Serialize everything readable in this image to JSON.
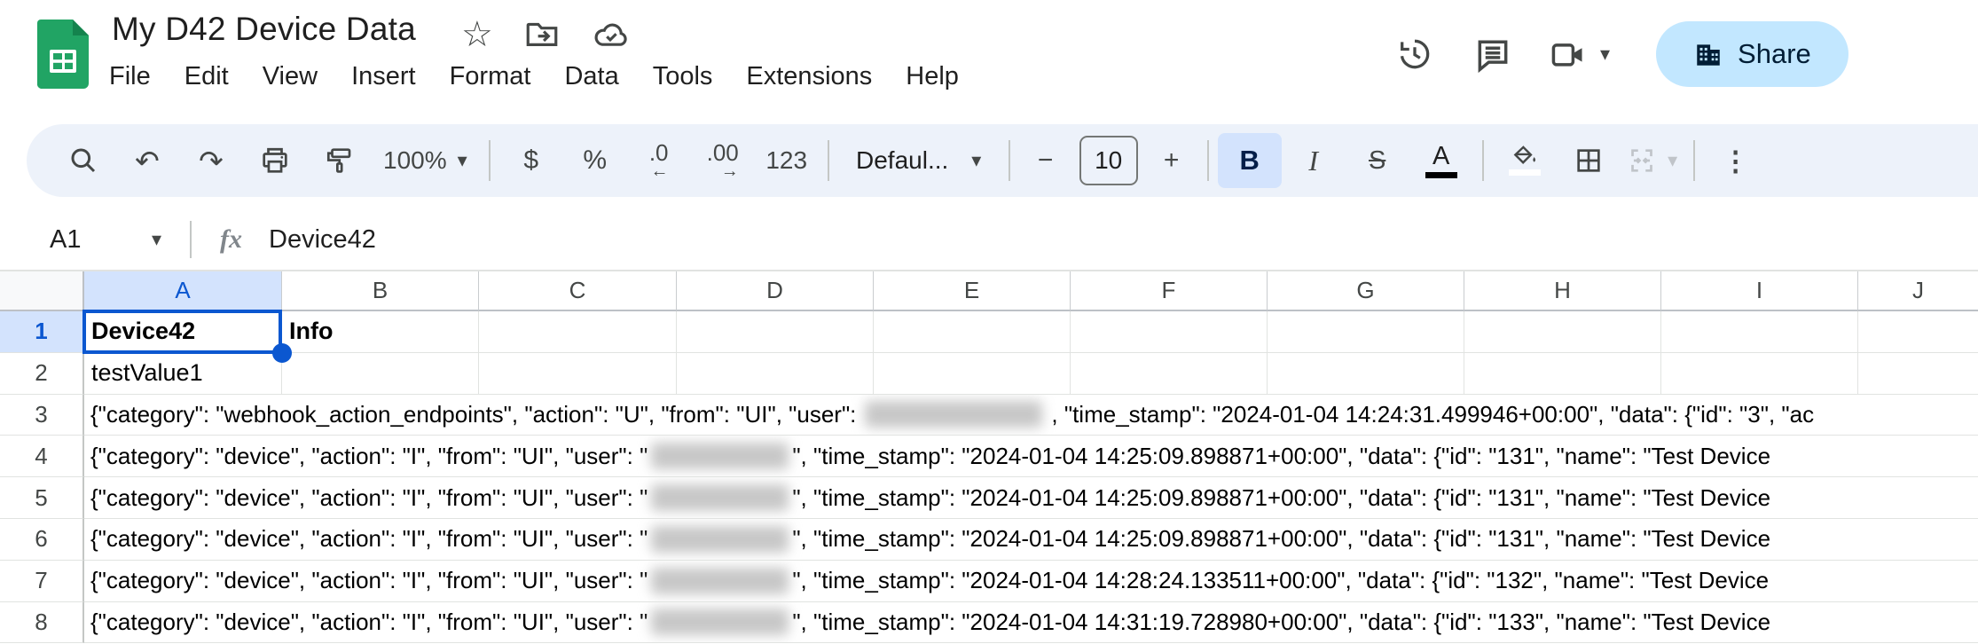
{
  "header": {
    "title": "My D42 Device Data",
    "menus": [
      "File",
      "Edit",
      "View",
      "Insert",
      "Format",
      "Data",
      "Tools",
      "Extensions",
      "Help"
    ],
    "share_label": "Share"
  },
  "icons": {
    "star": "☆",
    "caret": "▾",
    "undo": "↶",
    "redo": "↷",
    "more_vertical": "⋮",
    "minus": "−",
    "plus": "+",
    "arrow_left": "←",
    "arrow_right": "→"
  },
  "toolbar": {
    "zoom": "100%",
    "currency": "$",
    "percent": "%",
    "decrease_decimal": ".0",
    "increase_decimal": ".00",
    "more_formats": "123",
    "font_name": "Defaul...",
    "font_size": "10",
    "bold": "B",
    "italic": "I",
    "strikethrough": "S",
    "text_color": "A"
  },
  "formula_bar": {
    "cell_ref": "A1",
    "fx": "fx",
    "value": "Device42"
  },
  "colors": {
    "accent_blue": "#0b57d0",
    "share_bg": "#c2e7ff",
    "toolbar_bg": "#edf2fa",
    "selection_header_bg": "#d3e3fd",
    "logo_green": "#21a464"
  },
  "grid": {
    "columns": [
      "A",
      "B",
      "C",
      "D",
      "E",
      "F",
      "G",
      "H",
      "I",
      "J"
    ],
    "selected_cell": "A1",
    "rows": [
      {
        "n": "1",
        "a": "Device42",
        "b": "Info"
      },
      {
        "n": "2",
        "a": "testValue1"
      },
      {
        "n": "3",
        "pre": "{\"category\": \"webhook_action_endpoints\", \"action\": \"U\", \"from\": \"UI\", \"user\":",
        "redacted": true,
        "post": ", \"time_stamp\": \"2024-01-04 14:24:31.499946+00:00\", \"data\": {\"id\": \"3\", \"ac"
      },
      {
        "n": "4",
        "pre": "{\"category\": \"device\", \"action\": \"I\", \"from\": \"UI\", \"user\": \"",
        "redacted": true,
        "post": "\", \"time_stamp\": \"2024-01-04 14:25:09.898871+00:00\", \"data\": {\"id\": \"131\", \"name\": \"Test Device"
      },
      {
        "n": "5",
        "pre": "{\"category\": \"device\", \"action\": \"I\", \"from\": \"UI\", \"user\": \"",
        "redacted": true,
        "post": "\", \"time_stamp\": \"2024-01-04 14:25:09.898871+00:00\", \"data\": {\"id\": \"131\", \"name\": \"Test Device"
      },
      {
        "n": "6",
        "pre": "{\"category\": \"device\", \"action\": \"I\", \"from\": \"UI\", \"user\": \"",
        "redacted": true,
        "post": "\", \"time_stamp\": \"2024-01-04 14:25:09.898871+00:00\", \"data\": {\"id\": \"131\", \"name\": \"Test Device"
      },
      {
        "n": "7",
        "pre": "{\"category\": \"device\", \"action\": \"I\", \"from\": \"UI\", \"user\": \"",
        "redacted": true,
        "post": "\", \"time_stamp\": \"2024-01-04 14:28:24.133511+00:00\", \"data\": {\"id\": \"132\", \"name\": \"Test Device"
      },
      {
        "n": "8",
        "pre": "{\"category\": \"device\", \"action\": \"I\", \"from\": \"UI\", \"user\": \"",
        "redacted": true,
        "post": "\", \"time_stamp\": \"2024-01-04 14:31:19.728980+00:00\", \"data\": {\"id\": \"133\", \"name\": \"Test Device"
      }
    ]
  }
}
